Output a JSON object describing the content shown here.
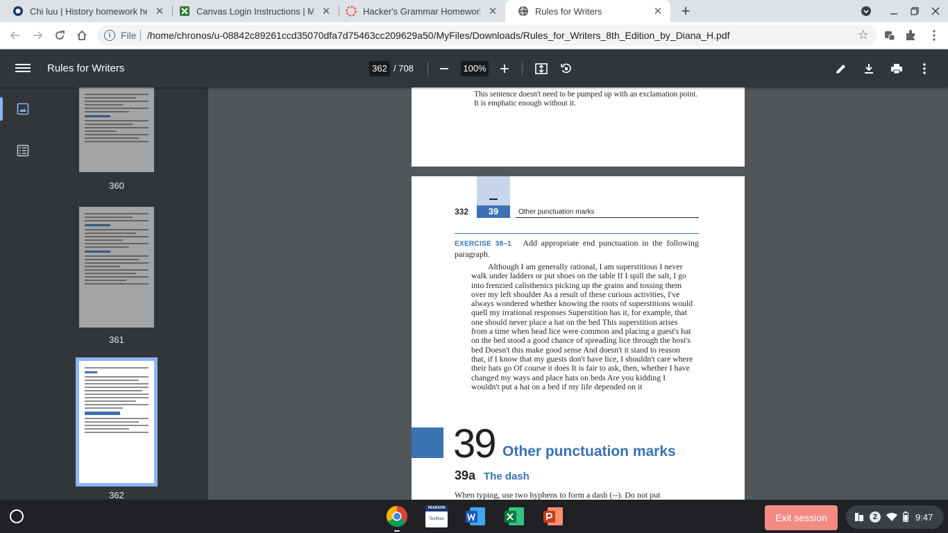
{
  "tabs": [
    {
      "title": "Chi luu | History homework help",
      "favicon": "chegg-icon",
      "close": "✕"
    },
    {
      "title": "Canvas Login Instructions | Miss",
      "favicon": "canvas-icon",
      "close": "✕"
    },
    {
      "title": "Hacker's Grammar Homework II",
      "favicon": "canvas-red-icon",
      "close": "✕"
    },
    {
      "title": "Rules for Writers",
      "favicon": "globe-icon",
      "close": "✕",
      "active": true
    }
  ],
  "omnibox": {
    "scheme": "File",
    "url": "/home/chronos/u-08842c89261ccd35070dfa7d75463cc209629a50/MyFiles/Downloads/Rules_for_Writers_8th_Edition_by_Diana_H.pdf"
  },
  "pdf": {
    "title": "Rules for Writers",
    "current_page": "362",
    "total_pages": "/ 708",
    "zoom": "100%"
  },
  "thumbnails": [
    {
      "label": "360"
    },
    {
      "label": "361"
    },
    {
      "label": "362",
      "selected": true
    }
  ],
  "page_prev": {
    "text": "This sentence doesn't need to be pumped up with an exclamation point. It is emphatic enough without it."
  },
  "page_current": {
    "page_number": "332",
    "chapter_box": "39",
    "running_head": "Other punctuation marks",
    "exercise_label": "EXERCISE 38–1",
    "exercise_instruction": "Add appropriate end punctuation in the following paragraph.",
    "exercise_paragraph": "Although I am generally rational, I am superstitious I never walk under ladders or put shoes on the table If I spill the salt, I go into frenzied calisthenics picking up the grains and tossing them over my left shoulder As a result of these curious activities, I've always wondered whether knowing the roots of superstitions would quell my irrational responses Superstition has it, for example, that one should never place a hat on the bed This superstition arises from a time when head lice were common and placing a guest's hat on the bed stood a good chance of spreading lice through the host's bed Doesn't this make good sense And doesn't it stand to reason that, if I know that my guests don't have lice, I shouldn't care where their hats go Of course it does It is fair to ask, then, whether I have changed my ways and place hats on beds Are you kidding I wouldn't put a hat on a bed if my life depended on it",
    "chapter_number": "39",
    "chapter_title": "Other punctuation marks",
    "section_number": "39a",
    "section_title": "The dash",
    "section_body": "When typing, use two hyphens to form a dash (--). Do not put"
  },
  "shelf": {
    "exit_label": "Exit session",
    "badge": "2",
    "time": "9:47",
    "pearson_label": "PEARSON",
    "testnav_label": "TestNav"
  },
  "colors": {
    "accent_blue": "#3a72b3",
    "exit_button": "#f28b82",
    "pdf_toolbar": "#323639"
  }
}
